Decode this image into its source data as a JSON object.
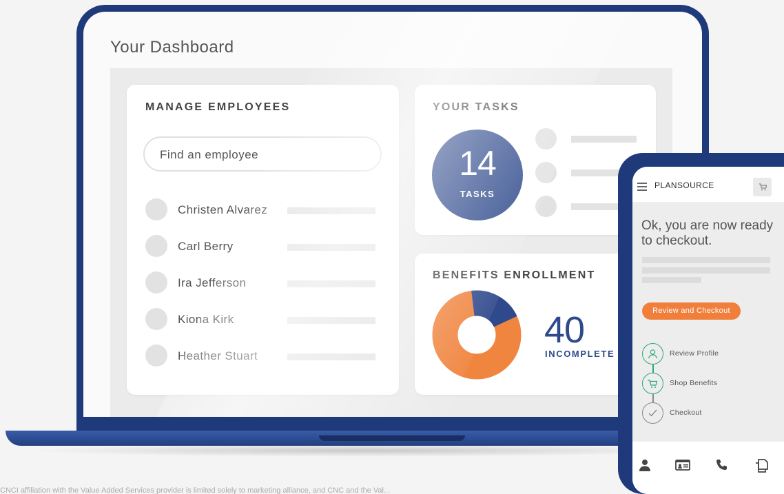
{
  "dashboard": {
    "title": "Your Dashboard",
    "manage_employees": {
      "title": "MANAGE EMPLOYEES",
      "search_placeholder": "Find an employee",
      "employees": [
        "Christen Alvarez",
        "Carl Berry",
        "Ira Jefferson",
        "Kiona Kirk",
        "Heather Stuart"
      ]
    },
    "your_tasks": {
      "title": "YOUR TASKS",
      "count": "14",
      "count_label": "TASKS"
    },
    "benefits": {
      "title": "BENEFITS ENROLLMENT",
      "value": "40",
      "value_label": "INCOMPLETE",
      "complete_fraction": 0.2,
      "colors": {
        "incomplete": "#f08540",
        "complete": "#2f4a8c"
      }
    }
  },
  "phone": {
    "brand": "PLANSOURCE",
    "heading": "Ok, you are now ready to checkout.",
    "button": "Review and Checkout",
    "steps": [
      {
        "label": "Review Profile",
        "icon": "user-icon",
        "status": "done"
      },
      {
        "label": "Shop Benefits",
        "icon": "cart-icon",
        "status": "done"
      },
      {
        "label": "Checkout",
        "icon": "check-icon",
        "status": "pending"
      }
    ],
    "footer_icons": [
      "person-icon",
      "id-card-icon",
      "phone-icon",
      "documents-icon"
    ]
  },
  "disclaimer": "CNCI affiliation with the Value Added Services provider is limited solely to marketing alliance, and CNC and the Val..."
}
